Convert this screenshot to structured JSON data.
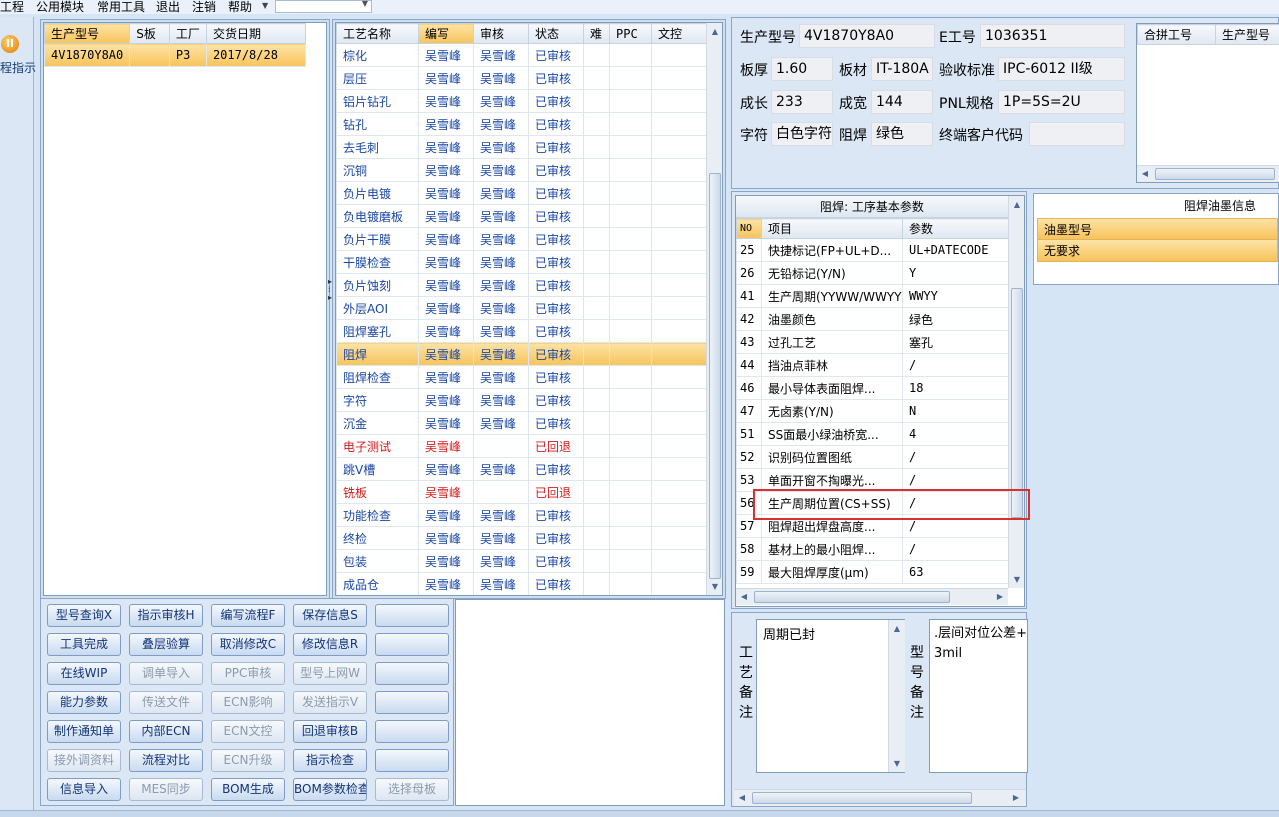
{
  "menu": [
    "工程",
    "公用模块",
    "常用工具",
    "退出",
    "注销",
    "帮助"
  ],
  "nav": {
    "label": "程指示"
  },
  "orders": {
    "columns": [
      "生产型号",
      "S板",
      "工厂",
      "交货日期"
    ],
    "rows": [
      {
        "model": "4V1870Y8A0",
        "s": "",
        "factory": "P3",
        "date": "2017/8/28"
      }
    ]
  },
  "process": {
    "columns": [
      "工艺名称",
      "编写",
      "审核",
      "状态",
      "难",
      "PPC",
      "文控"
    ],
    "rows": [
      {
        "name": "棕化",
        "writer": "吴雪峰",
        "reviewer": "吴雪峰",
        "status": "已审核"
      },
      {
        "name": "层压",
        "writer": "吴雪峰",
        "reviewer": "吴雪峰",
        "status": "已审核"
      },
      {
        "name": "铝片钻孔",
        "writer": "吴雪峰",
        "reviewer": "吴雪峰",
        "status": "已审核"
      },
      {
        "name": "钻孔",
        "writer": "吴雪峰",
        "reviewer": "吴雪峰",
        "status": "已审核"
      },
      {
        "name": "去毛刺",
        "writer": "吴雪峰",
        "reviewer": "吴雪峰",
        "status": "已审核"
      },
      {
        "name": "沉铜",
        "writer": "吴雪峰",
        "reviewer": "吴雪峰",
        "status": "已审核"
      },
      {
        "name": "负片电镀",
        "writer": "吴雪峰",
        "reviewer": "吴雪峰",
        "status": "已审核"
      },
      {
        "name": "负电镀磨板",
        "writer": "吴雪峰",
        "reviewer": "吴雪峰",
        "status": "已审核"
      },
      {
        "name": "负片干膜",
        "writer": "吴雪峰",
        "reviewer": "吴雪峰",
        "status": "已审核"
      },
      {
        "name": "干膜检查",
        "writer": "吴雪峰",
        "reviewer": "吴雪峰",
        "status": "已审核"
      },
      {
        "name": "负片蚀刻",
        "writer": "吴雪峰",
        "reviewer": "吴雪峰",
        "status": "已审核"
      },
      {
        "name": "外层AOI",
        "writer": "吴雪峰",
        "reviewer": "吴雪峰",
        "status": "已审核"
      },
      {
        "name": "阻焊塞孔",
        "writer": "吴雪峰",
        "reviewer": "吴雪峰",
        "status": "已审核"
      },
      {
        "name": "阻焊",
        "writer": "吴雪峰",
        "reviewer": "吴雪峰",
        "status": "已审核",
        "selected": true
      },
      {
        "name": "阻焊检查",
        "writer": "吴雪峰",
        "reviewer": "吴雪峰",
        "status": "已审核"
      },
      {
        "name": "字符",
        "writer": "吴雪峰",
        "reviewer": "吴雪峰",
        "status": "已审核"
      },
      {
        "name": "沉金",
        "writer": "吴雪峰",
        "reviewer": "吴雪峰",
        "status": "已审核"
      },
      {
        "name": "电子测试",
        "writer": "吴雪峰",
        "reviewer": "",
        "status": "已回退",
        "returned": true
      },
      {
        "name": "跳V槽",
        "writer": "吴雪峰",
        "reviewer": "吴雪峰",
        "status": "已审核"
      },
      {
        "name": "铣板",
        "writer": "吴雪峰",
        "reviewer": "",
        "status": "已回退",
        "returned": true
      },
      {
        "name": "功能检查",
        "writer": "吴雪峰",
        "reviewer": "吴雪峰",
        "status": "已审核"
      },
      {
        "name": "终检",
        "writer": "吴雪峰",
        "reviewer": "吴雪峰",
        "status": "已审核"
      },
      {
        "name": "包装",
        "writer": "吴雪峰",
        "reviewer": "吴雪峰",
        "status": "已审核"
      },
      {
        "name": "成品仓",
        "writer": "吴雪峰",
        "reviewer": "吴雪峰",
        "status": "已审核"
      }
    ]
  },
  "buttons": [
    {
      "label": "型号查询X",
      "enabled": true
    },
    {
      "label": "指示审核H",
      "enabled": true
    },
    {
      "label": "编写流程F",
      "enabled": true
    },
    {
      "label": "保存信息S",
      "enabled": true
    },
    {
      "label": "",
      "enabled": true
    },
    {
      "label": "工具完成",
      "enabled": true
    },
    {
      "label": "叠层验算",
      "enabled": true
    },
    {
      "label": "取消修改C",
      "enabled": true
    },
    {
      "label": "修改信息R",
      "enabled": true
    },
    {
      "label": "",
      "enabled": true
    },
    {
      "label": "在线WIP",
      "enabled": true
    },
    {
      "label": "调单导入",
      "enabled": false
    },
    {
      "label": "PPC审核",
      "enabled": false
    },
    {
      "label": "型号上网W",
      "enabled": false
    },
    {
      "label": "",
      "enabled": true
    },
    {
      "label": "能力参数",
      "enabled": true
    },
    {
      "label": "传送文件",
      "enabled": false
    },
    {
      "label": "ECN影响",
      "enabled": false
    },
    {
      "label": "发送指示V",
      "enabled": false
    },
    {
      "label": "",
      "enabled": true
    },
    {
      "label": "制作通知单",
      "enabled": true
    },
    {
      "label": "内部ECN",
      "enabled": true
    },
    {
      "label": "ECN文控",
      "enabled": false
    },
    {
      "label": "回退审核B",
      "enabled": true
    },
    {
      "label": "",
      "enabled": true
    },
    {
      "label": "接外调资料",
      "enabled": false
    },
    {
      "label": "流程对比",
      "enabled": true
    },
    {
      "label": "ECN升级",
      "enabled": false
    },
    {
      "label": "指示检查",
      "enabled": true
    },
    {
      "label": "",
      "enabled": true
    },
    {
      "label": "信息导入",
      "enabled": true
    },
    {
      "label": "MES同步",
      "enabled": false
    },
    {
      "label": "BOM生成",
      "enabled": true
    },
    {
      "label": "BOM参数检查",
      "enabled": true
    },
    {
      "label": "选择母板",
      "enabled": false
    }
  ],
  "info": {
    "model_label": "生产型号",
    "model": "4V1870Y8A0",
    "eno_label": "E工号",
    "eno": "1036351",
    "thick_label": "板厚",
    "thick": "1.60",
    "material_label": "板材",
    "material": "IT-180A",
    "std_label": "验收标准",
    "std": "IPC-6012 II级",
    "len_label": "成长",
    "len": "233",
    "wid_label": "成宽",
    "wid": "144",
    "pnl_label": "PNL规格",
    "pnl": "1P=5S=2U",
    "char_label": "字符",
    "char": "白色字符",
    "mask_label": "阻焊",
    "mask": "绿色",
    "cust_label": "终端客户代码",
    "cust": ""
  },
  "merge": {
    "columns": [
      "合拼工号",
      "生产型号"
    ]
  },
  "params": {
    "title": "阻焊: 工序基本参数",
    "columns": [
      "NO",
      "项目",
      "参数"
    ],
    "rows": [
      {
        "no": "25",
        "item": "快捷标记(FP+UL+D...",
        "value": "UL+DATECODE"
      },
      {
        "no": "26",
        "item": "无铅标记(Y/N)",
        "value": "Y"
      },
      {
        "no": "41",
        "item": "生产周期(YYWW/WWYY)",
        "value": "WWYY"
      },
      {
        "no": "42",
        "item": "油墨颜色",
        "value": "绿色"
      },
      {
        "no": "43",
        "item": "过孔工艺",
        "value": "塞孔"
      },
      {
        "no": "44",
        "item": "挡油点菲林",
        "value": "/"
      },
      {
        "no": "46",
        "item": "最小导体表面阻焊...",
        "value": "18"
      },
      {
        "no": "47",
        "item": "无卤素(Y/N)",
        "value": "N"
      },
      {
        "no": "51",
        "item": "SS面最小绿油桥宽...",
        "value": "4"
      },
      {
        "no": "52",
        "item": "识别码位置图纸",
        "value": "/"
      },
      {
        "no": "53",
        "item": "单面开窗不掏曝光...",
        "value": "/"
      },
      {
        "no": "56",
        "item": "生产周期位置(CS+SS)",
        "value": "/"
      },
      {
        "no": "57",
        "item": "阻焊超出焊盘高度...",
        "value": "/"
      },
      {
        "no": "58",
        "item": "基材上的最小阻焊...",
        "value": "/"
      },
      {
        "no": "59",
        "item": "最大阻焊厚度(μm)",
        "value": "63"
      }
    ]
  },
  "ink": {
    "title": "阻焊油墨信息",
    "column": "油墨型号",
    "row": "无要求"
  },
  "notes": {
    "process_label": "工艺备注",
    "process_text": "周期已封",
    "model_label": "型号备注",
    "model_text_line1": ".层间对位公差+",
    "model_text_line2": "3mil"
  },
  "colors": {
    "selected": "#f7c35b",
    "returned": "#d21d1d",
    "highlight": "#d93030"
  }
}
